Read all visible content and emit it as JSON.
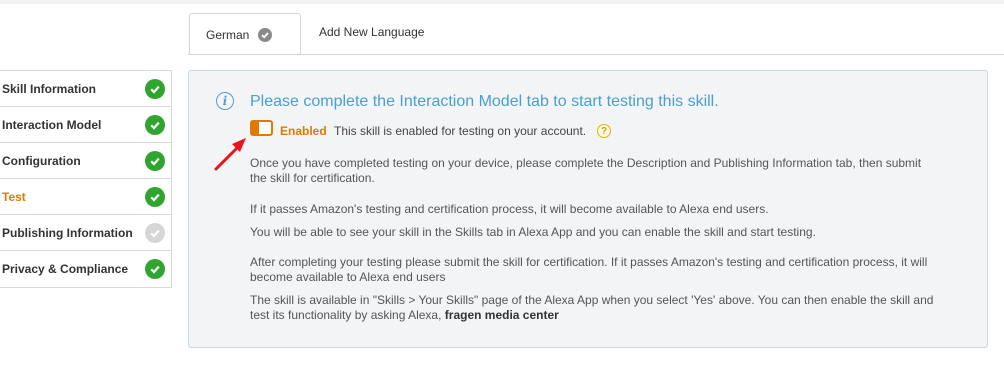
{
  "tabs": {
    "active": "German",
    "add_new": "Add New Language"
  },
  "sidebar": {
    "items": [
      {
        "label": "Skill Information",
        "status": "complete"
      },
      {
        "label": "Interaction Model",
        "status": "complete"
      },
      {
        "label": "Configuration",
        "status": "complete"
      },
      {
        "label": "Test",
        "status": "complete"
      },
      {
        "label": "Publishing Information",
        "status": "incomplete"
      },
      {
        "label": "Privacy & Compliance",
        "status": "complete"
      }
    ]
  },
  "main": {
    "headline": "Please complete the Interaction Model tab to start testing this skill.",
    "toggle_label": "Enabled",
    "toggle_desc": "This skill is enabled for testing on your account.",
    "help_glyph": "?",
    "info_glyph": "i",
    "para1": "Once you have completed testing on your device, please complete the Description and Publishing Information tab, then submit the skill for certification.",
    "para2": "If it passes Amazon's testing and certification process, it will become available to Alexa end users.",
    "para3": "You will be able to see your skill in the Skills tab in Alexa App and you can enable the skill and start testing.",
    "para4": "After completing your testing please submit the skill for certification. If it passes Amazon's testing and certification process, it will become available to Alexa end users",
    "para5_prefix": "The skill is available in \"Skills > Your Skills\" page of the Alexa App when you select 'Yes' above. You can then enable the skill and test its functionality by asking Alexa,",
    "para5_phrase": "fragen media center"
  },
  "colors": {
    "accent_orange": "#e07b00",
    "success_green": "#2fa530",
    "headline_blue": "#4a9fd0",
    "annotation_red": "#e8141c"
  }
}
